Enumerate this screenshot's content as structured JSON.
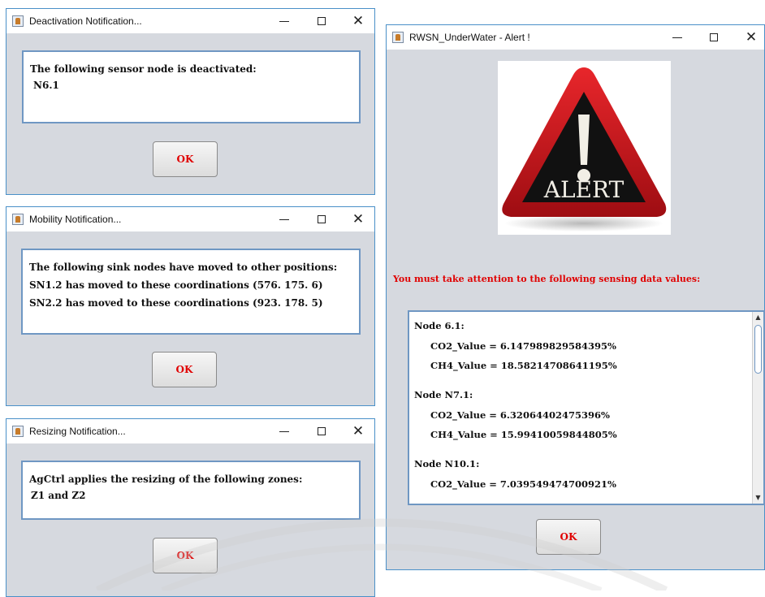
{
  "deactivation": {
    "title": "Deactivation Notification...",
    "line1": "The following sensor node is deactivated:",
    "line2": "N6.1",
    "ok": "OK"
  },
  "mobility": {
    "title": "Mobility Notification...",
    "line1": "The following sink nodes have moved to other positions:",
    "line2": "SN1.2 has moved to these coordinations (576. 175. 6)",
    "line3": "SN2.2 has moved to these coordinations (923. 178. 5)",
    "ok": "OK"
  },
  "resizing": {
    "title": "Resizing Notification...",
    "line1": "AgCtrl applies the resizing of the following zones:",
    "line2": "Z1 and Z2",
    "ok": "OK"
  },
  "alert": {
    "title": "RWSN_UnderWater - Alert !",
    "image_text": "ALERT",
    "warning": "You must take attention to the following sensing data values:",
    "lines": [
      "Node 6.1:",
      "CO2_Value = 6.147989829584395%",
      "CH4_Value = 18.58214708641195%",
      "Node N7.1:",
      "CO2_Value = 6.32064402475396%",
      "CH4_Value = 15.99410059844805%",
      "Node N10.1:",
      "CO2_Value = 7.039549474700921%"
    ],
    "ok": "OK"
  },
  "titlebar_buttons": {
    "minimize": "minimize",
    "maximize": "maximize",
    "close": "✕"
  },
  "colors": {
    "window_border": "#4a90c8",
    "window_body": "#d6d9df",
    "ok_text": "#e00000",
    "warning_text": "#e00000"
  }
}
